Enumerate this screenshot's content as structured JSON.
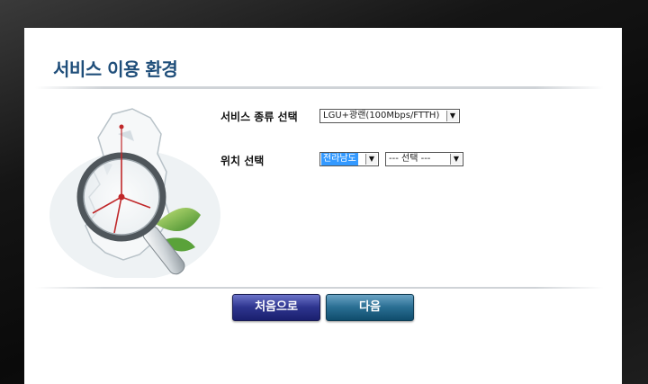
{
  "page": {
    "title": "서비스 이용 환경"
  },
  "form": {
    "service_type": {
      "label": "서비스 종류 선택",
      "selected": "LGU+광랜(100Mbps/FTTH)"
    },
    "location": {
      "label": "위치 선택",
      "region_selected": "전라남도",
      "city_selected": "--- 선택 ---"
    }
  },
  "buttons": {
    "first_label": "처음으로",
    "next_label": "다음"
  },
  "illustration": {
    "icon": "magnifier-over-korea-map-icon"
  },
  "colors": {
    "title": "#1f4e7a",
    "first_button": "#2e358f",
    "next_button": "#2a6f93",
    "selection_highlight": "#3399ff"
  }
}
